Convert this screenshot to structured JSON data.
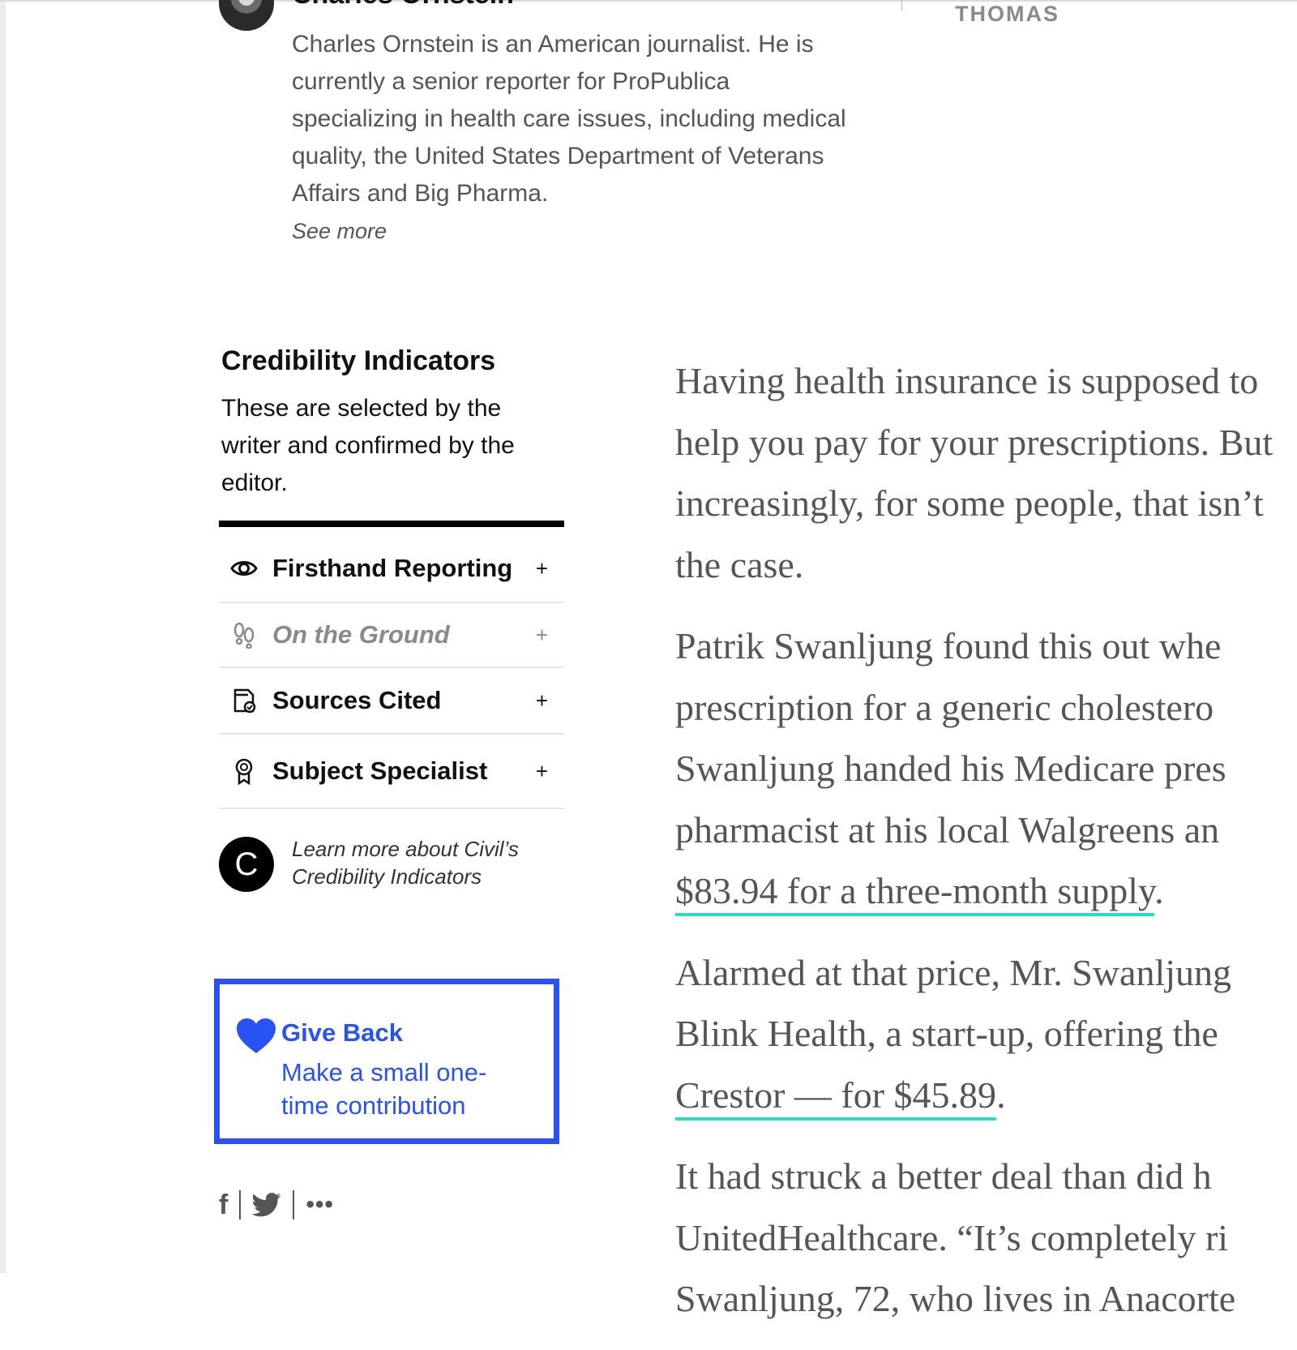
{
  "author": {
    "name": "Charles Ornstein",
    "bio": "Charles Ornstein is an American journalist. He is currently a senior reporter for ProPublica specializing in health care issues, including medical quality, the United States Department of Veterans Affairs and Big Pharma.",
    "see_more": "See more",
    "other_author": "THOMAS"
  },
  "credibility": {
    "title": "Credibility Indicators",
    "description": "These are selected by the writer and confirmed by the editor.",
    "items": [
      {
        "label": "Firsthand Reporting",
        "icon": "eye-icon",
        "expand": "+"
      },
      {
        "label": "On the Ground",
        "icon": "footprints-icon",
        "expand": "+"
      },
      {
        "label": "Sources Cited",
        "icon": "document-check-icon",
        "expand": "+"
      },
      {
        "label": "Subject Specialist",
        "icon": "award-ribbon-icon",
        "expand": "+"
      }
    ],
    "civil_logo": "C",
    "learn_more": "Learn more about Civil’s Credibility Indicators"
  },
  "give_back": {
    "title": "Give Back",
    "subtitle": "Make a small one-time contribution",
    "color": "#2952f5"
  },
  "share": {
    "facebook": "f",
    "more": "•••"
  },
  "article": {
    "p1": "Having health insurance is supposed to help you pay for your prescriptions. But increasingly, for some people, that isn’t the case.",
    "p2_lines": [
      "Patrik Swanljung found this out whe",
      "prescription for a generic cholestero",
      "Swanljung handed his Medicare pres",
      "pharmacist at his local Walgreens an"
    ],
    "p2_link": "$83.94 for a three-month supply",
    "p3_lines": [
      "Alarmed at that price, Mr. Swanljung",
      "Blink Health, a start-up, offering the"
    ],
    "p3_link": "Crestor — for $45.89",
    "p4_lines": [
      "It had struck a better deal than did h",
      "UnitedHealthcare. “It’s completely ri",
      "Swanljung, 72, who lives in Anacorte"
    ],
    "link_color": "#2ddcc0"
  }
}
